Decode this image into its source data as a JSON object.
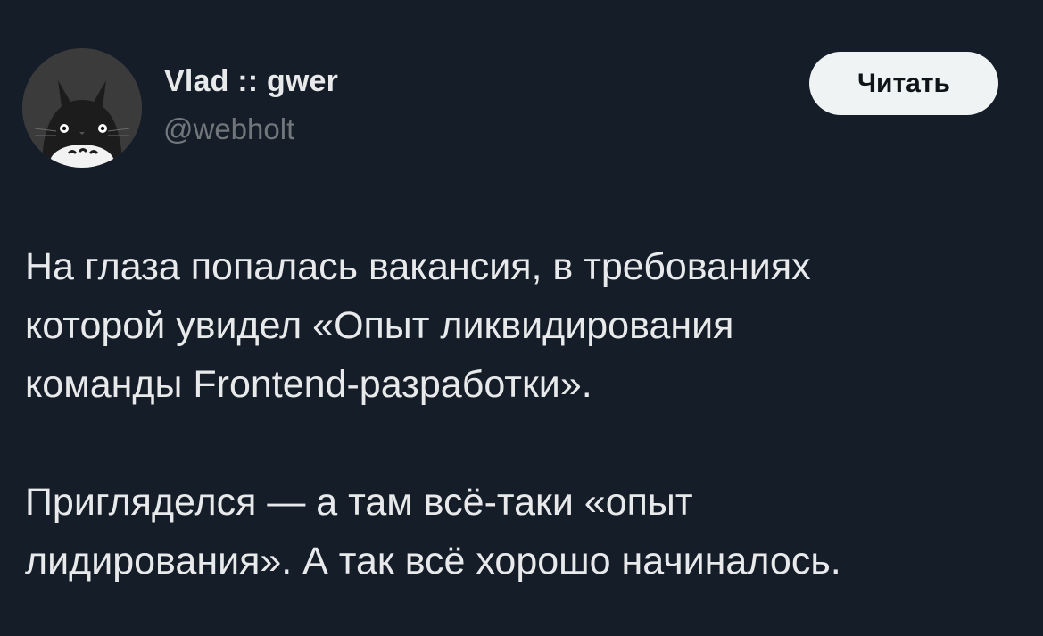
{
  "author": {
    "display_name": "Vlad :: gwer",
    "handle": "@webholt",
    "avatar_icon": "totoro-avatar-icon"
  },
  "follow_button": {
    "label": "Читать"
  },
  "tweet": {
    "lines": [
      "На глаза попалась вакансия, в требованиях",
      "которой увидел «Опыт ликвидирования",
      "команды Frontend-разработки».",
      "",
      "Пригляделся — а там всё-таки «опыт",
      "лидирования». А так всё хорошо начиналось."
    ]
  },
  "colors": {
    "background": "#151d28",
    "text": "#e7e9ea",
    "secondary_text": "#71767b",
    "button_bg": "#eff3f4",
    "button_text": "#0f1419"
  }
}
